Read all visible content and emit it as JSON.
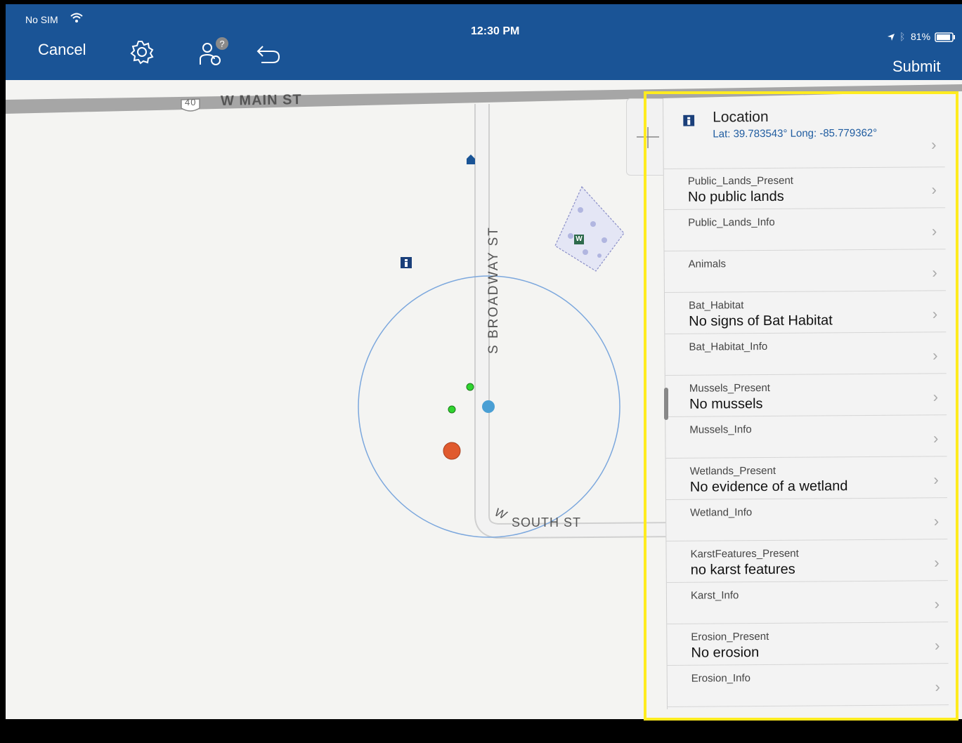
{
  "status": {
    "carrier": "No SIM",
    "time": "12:30 PM",
    "battery": "81%"
  },
  "toolbar": {
    "cancel": "Cancel",
    "submit": "Submit"
  },
  "icons": {
    "wifi": "wifi-icon",
    "settings": "gear-icon",
    "help": "user-help-icon",
    "undo": "undo-icon",
    "location_arrow": "location-arrow-icon",
    "bluetooth": "bluetooth-icon",
    "battery": "battery-icon",
    "info": "info-icon",
    "chevron": "chevron-right-icon"
  },
  "map": {
    "roads": {
      "main": "W MAIN ST",
      "route": "40",
      "broadway": "S BROADWAY ST",
      "south": "SOUTH ST",
      "south_prefix": "W"
    },
    "marker_w": "W"
  },
  "panel": {
    "location": {
      "title": "Location",
      "coords": "Lat: 39.783543° Long: -85.779362°"
    },
    "rows": [
      {
        "label": "Public_Lands_Present",
        "value": "No public lands"
      },
      {
        "label": "Public_Lands_Info",
        "value": ""
      },
      {
        "label": "Animals",
        "value": ""
      },
      {
        "label": "Bat_Habitat",
        "value": "No signs of Bat Habitat"
      },
      {
        "label": "Bat_Habitat_Info",
        "value": ""
      },
      {
        "label": "Mussels_Present",
        "value": "No mussels"
      },
      {
        "label": "Mussels_Info",
        "value": ""
      },
      {
        "label": "Wetlands_Present",
        "value": "No evidence of a wetland"
      },
      {
        "label": "Wetland_Info",
        "value": ""
      },
      {
        "label": "KarstFeatures_Present",
        "value": "no karst features"
      },
      {
        "label": "Karst_Info",
        "value": ""
      },
      {
        "label": "Erosion_Present",
        "value": "No erosion"
      },
      {
        "label": "Erosion_Info",
        "value": ""
      }
    ]
  },
  "colors": {
    "toolbar": "#1a5496",
    "highlight": "#ffeb1f",
    "point_blue": "#4a9fd4",
    "point_orange": "#e05a2e",
    "point_green": "#2fd42f"
  }
}
